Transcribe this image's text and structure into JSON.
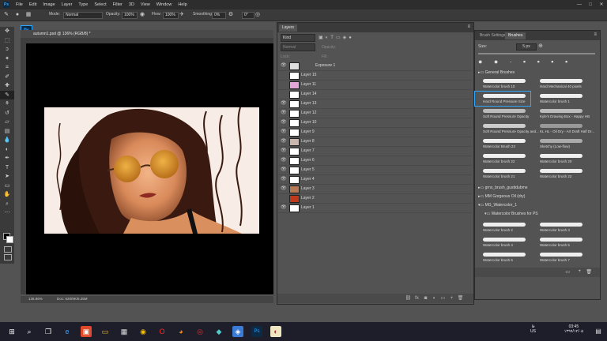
{
  "menubar": {
    "logo": "Ps",
    "items": [
      "File",
      "Edit",
      "Image",
      "Layer",
      "Type",
      "Select",
      "Filter",
      "3D",
      "View",
      "Window",
      "Help"
    ],
    "window_controls": [
      "—",
      "□",
      "✕"
    ]
  },
  "options": {
    "mode_label": "Mode:",
    "mode_value": "Normal",
    "opacity_label": "Opacity:",
    "opacity_value": "100%",
    "flow_label": "Flow:",
    "flow_value": "100%",
    "smoothing_label": "Smoothing:",
    "smoothing_value": "0%",
    "angle_value": "0°"
  },
  "document": {
    "app_badge": "Ps",
    "tab_title": "autumn1.psd @ 136% (RGB/8) *",
    "zoom": "135.86%",
    "doc_info": "Doc: 620/9K/6.25M"
  },
  "layers": {
    "tab": "Layers",
    "filter": "Kind",
    "blend_mode": "Normal",
    "opacity_label": "Opacity:",
    "lock_label": "Lock:",
    "fill_label": "Fill:",
    "rows": [
      {
        "name": "Exposure 1"
      },
      {
        "name": "Layer 15"
      },
      {
        "name": "Layer 11"
      },
      {
        "name": "Layer 14"
      },
      {
        "name": "Layer 13"
      },
      {
        "name": "Layer 12"
      },
      {
        "name": "Layer 10"
      },
      {
        "name": "Layer 9"
      },
      {
        "name": "Layer 8"
      },
      {
        "name": "Layer 7"
      },
      {
        "name": "Layer 6"
      },
      {
        "name": "Layer 5"
      },
      {
        "name": "Layer 4"
      },
      {
        "name": "Layer 3"
      },
      {
        "name": "Layer 2"
      },
      {
        "name": "Layer 1"
      }
    ]
  },
  "brush": {
    "tab_settings": "Brush Settings",
    "tab_brushes": "Brushes",
    "size_label": "Size:",
    "size_value": "5 px",
    "group_general": "General Brushes",
    "brushes": [
      {
        "name": "Watercolor brush 10"
      },
      {
        "name": "Hard Mechanical 40 pixels"
      },
      {
        "name": "Hard Round Pressure Size"
      },
      {
        "name": "Watercolor brush 1"
      },
      {
        "name": "Soft Round Pressure Opacity"
      },
      {
        "name": "Kyle's Drawing Box - Happy HB"
      },
      {
        "name": "Soft Round Pressure Opacity and..."
      },
      {
        "name": "KL HL - Oil Dry - Art Draft Half Dr..."
      },
      {
        "name": "Watercolor Brush 23"
      },
      {
        "name": "Sketchy (Low-flow)"
      },
      {
        "name": "Watercolor brush 22"
      },
      {
        "name": "Watercolor brush 20"
      },
      {
        "name": "Watercolor brush 21"
      },
      {
        "name": "Watercolor brush 22"
      }
    ],
    "groups": [
      "grns_brush_gusttdubme",
      "MM Gorgeous Oil (dry)",
      "MG_Watercolor_1",
      "Watercolor Brushes for PS"
    ],
    "brushes2": [
      {
        "name": "Watercolor brush 2"
      },
      {
        "name": "Watercolor brush 3"
      },
      {
        "name": "Watercolor brush 4"
      },
      {
        "name": "Watercolor brush 5"
      },
      {
        "name": "Watercolor brush 6"
      },
      {
        "name": "Watercolor brush 7"
      }
    ]
  },
  "taskbar": {
    "time": "03:45",
    "date": "۱۳۹۹/۱۲/۰۵",
    "lang1": "فا",
    "lang2": "US"
  }
}
